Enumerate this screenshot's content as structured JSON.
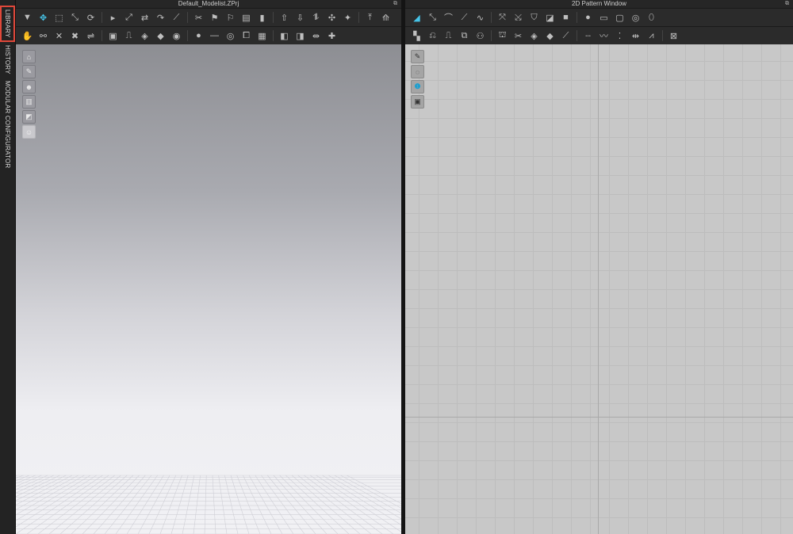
{
  "sidebar": {
    "tabs": [
      {
        "label": "LIBRARY",
        "active": true
      },
      {
        "label": "HISTORY",
        "active": false
      },
      {
        "label": "MODULAR CONFIGURATOR",
        "active": false
      }
    ]
  },
  "panel3d": {
    "title": "Default_Modelist.ZPrj",
    "float_icon": "⧉",
    "toolbar_row1": [
      "▼",
      "✥",
      "⬚",
      "⤡",
      "⟳",
      "▸",
      "⤢",
      "⇄",
      "↷",
      "⟋",
      "✂",
      "⚑",
      "⚐",
      "▤",
      "▮",
      "⇧",
      "⇩",
      "⥮",
      "✣",
      "✦",
      "⤒",
      "⟰"
    ],
    "toolbar_row2": [
      "✋",
      "⚯",
      "✕",
      "✖",
      "⇌",
      "▣",
      "⎍",
      "◈",
      "◆",
      "◉",
      "●",
      "—",
      "◎",
      "⧠",
      "▦",
      "◧",
      "◨",
      "⇹",
      "✚"
    ],
    "side_tools": [
      "⌂",
      "✎",
      "☻",
      "▥",
      "◩",
      "☺"
    ]
  },
  "panel2d": {
    "title": "2D Pattern Window",
    "float_icon": "⧉",
    "toolbar_row1": [
      "◢",
      "⤡",
      "⌒",
      "⟋",
      "∿",
      "⤧",
      "⤩",
      "⛉",
      "◪",
      "■",
      "●",
      "▭",
      "▢",
      "◎",
      "⬯"
    ],
    "toolbar_row2": [
      "▚",
      "⎌",
      "⎍",
      "⧉",
      "⚇",
      "⛫",
      "✂",
      "◈",
      "◆",
      "⟋",
      "┄",
      "〰",
      "⁚",
      "⇹",
      "⩘",
      "⊠"
    ],
    "side_tools": [
      "✎",
      "◌",
      "❶",
      "▣"
    ]
  },
  "colors": {
    "active_tab_outline": "#e0483a",
    "selected_tool": "#46c4e8"
  }
}
